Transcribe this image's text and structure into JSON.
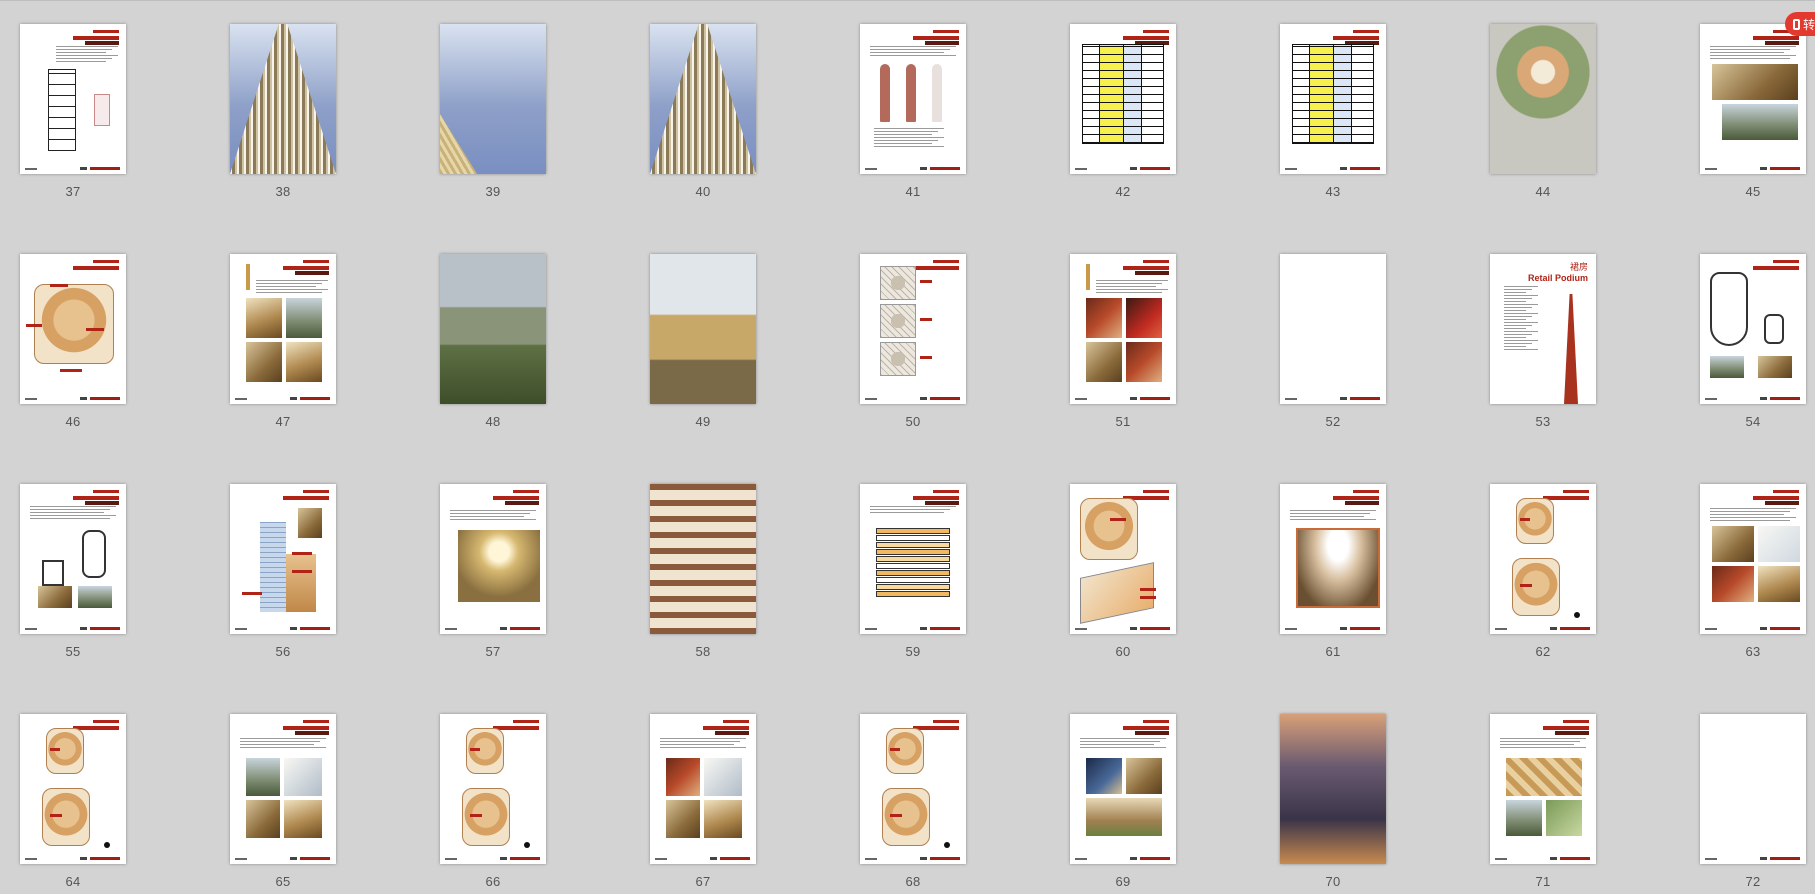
{
  "viewer": {
    "badge_label": "转",
    "badge_icon": "pdf-convert-icon"
  },
  "pages": [
    {
      "num": "37",
      "kind": "facade-detail",
      "title_cn": "表皮 | 幕墙详图",
      "title_en": "Facade | Curtain Wall Details"
    },
    {
      "num": "38",
      "kind": "tower-photo"
    },
    {
      "num": "39",
      "kind": "sky-photo"
    },
    {
      "num": "40",
      "kind": "tower-photo"
    },
    {
      "num": "41",
      "kind": "materials",
      "title_cn": "表皮 | 材料",
      "title_en": "Facade | Materials"
    },
    {
      "num": "42",
      "kind": "table"
    },
    {
      "num": "43",
      "kind": "table",
      "title_cn": "表皮 | 材料",
      "title_en": "Facade | Materials"
    },
    {
      "num": "44",
      "kind": "siteplan"
    },
    {
      "num": "45",
      "kind": "office-photos",
      "title_en": "Office | Sky"
    },
    {
      "num": "46",
      "kind": "plan-diagram"
    },
    {
      "num": "47",
      "kind": "office-lobby",
      "title_cn": "办公 | 大堂",
      "title_en": "Office | Lobby"
    },
    {
      "num": "48",
      "kind": "plaza-photo"
    },
    {
      "num": "49",
      "kind": "plaza-photo2"
    },
    {
      "num": "50",
      "kind": "floorplates"
    },
    {
      "num": "51",
      "kind": "office-support",
      "title_cn": "办公 | 办公配套设施",
      "title_en": "Office | Office Supporting Facilities"
    },
    {
      "num": "52",
      "kind": "blank"
    },
    {
      "num": "53",
      "kind": "retail-cover",
      "title_cn": "裙房",
      "title_en": "Retail Podium"
    },
    {
      "num": "54",
      "kind": "retail-sketch"
    },
    {
      "num": "55",
      "kind": "retail-scale",
      "title_cn": "商业 | 规模",
      "title_en": "Retail | Scale"
    },
    {
      "num": "56",
      "kind": "section"
    },
    {
      "num": "57",
      "kind": "atrium",
      "title_cn": "商业 | 竖向动线",
      "title_en": "Retail | Vertical Orientation"
    },
    {
      "num": "58",
      "kind": "mall-photo"
    },
    {
      "num": "59",
      "kind": "stacking",
      "title_cn": "商业 | 功能分布",
      "title_en": "Retail | Stacking"
    },
    {
      "num": "60",
      "kind": "axon"
    },
    {
      "num": "61",
      "kind": "basement",
      "title_cn": "商业 | 地下一层",
      "title_en": "Retail | Basement 1"
    },
    {
      "num": "62",
      "kind": "plans"
    },
    {
      "num": "63",
      "kind": "retail-l1",
      "title_cn": "商业 | 一层 首层大堂",
      "title_en": "Retail | L1-2 Luxury"
    },
    {
      "num": "64",
      "kind": "plans"
    },
    {
      "num": "65",
      "kind": "retail-l3",
      "title_cn": "商业 | 3-4层 时尚",
      "title_en": "Retail | L3-4 Fashion"
    },
    {
      "num": "66",
      "kind": "plans"
    },
    {
      "num": "67",
      "kind": "retail-l5",
      "title_cn": "商业 | 5-6层 品质生活",
      "title_en": "Retail | L5-6 Lifestyle"
    },
    {
      "num": "68",
      "kind": "plans"
    },
    {
      "num": "69",
      "kind": "retail-fb",
      "title_cn": "商业 | 7-8层 餐饮",
      "title_en": "Retail | L7-8 F&B"
    },
    {
      "num": "70",
      "kind": "night-photo"
    },
    {
      "num": "71",
      "kind": "roof",
      "title_cn": "商业 | 屋顶",
      "title_en": "Retail | Roof Terrace"
    },
    {
      "num": "72",
      "kind": "blank"
    }
  ]
}
